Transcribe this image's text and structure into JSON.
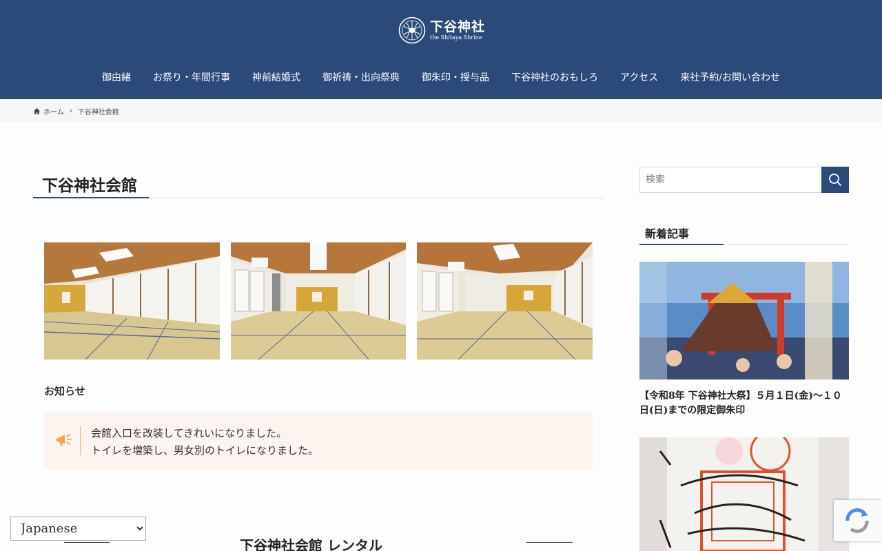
{
  "header": {
    "logo_name": "下谷神社",
    "logo_sub": "the Shitaya Shrine",
    "nav": [
      {
        "label": "御由緒"
      },
      {
        "label": "お祭り・年間行事"
      },
      {
        "label": "神前結婚式"
      },
      {
        "label": "御祈祷・出向祭典"
      },
      {
        "label": "御朱印・授与品"
      },
      {
        "label": "下谷神社のおもしろ"
      },
      {
        "label": "アクセス"
      },
      {
        "label": "来社予約/お問い合わせ"
      }
    ]
  },
  "breadcrumb": {
    "home": "ホーム",
    "current": "下谷神社会館"
  },
  "main": {
    "title": "下谷神社会館",
    "notice": {
      "heading": "お知らせ",
      "lines": [
        "会館入口を改装してきれいになりました。",
        "トイレを増築し、男女別のトイレになりました。"
      ]
    },
    "section_title": "下谷神社会館 レンタル"
  },
  "sidebar": {
    "search_placeholder": "検索",
    "recent_heading": "新着記事",
    "articles": [
      {
        "title": "【令和8年 下谷神社大祭】５月１日(金)〜１０日(日)までの限定御朱印"
      }
    ]
  },
  "language": {
    "selected": "Japanese"
  },
  "colors": {
    "brand": "#2b4a7a",
    "notice_bg": "#fdf3ef",
    "notice_accent": "#f0a94a"
  }
}
